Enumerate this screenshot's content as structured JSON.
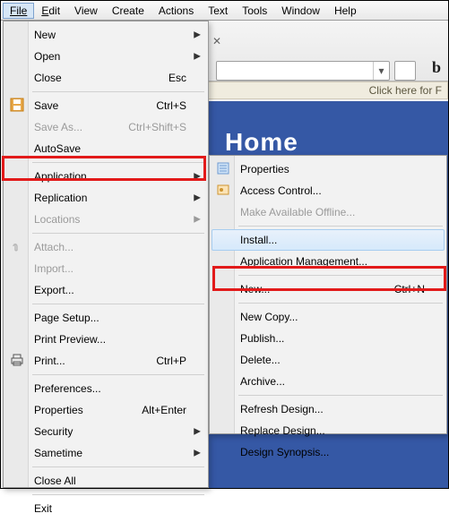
{
  "menubar": {
    "file": "File",
    "edit": "Edit",
    "view": "View",
    "create": "Create",
    "actions": "Actions",
    "text": "Text",
    "tools": "Tools",
    "window": "Window",
    "help": "Help"
  },
  "banner": {
    "click_here": "Click here for F"
  },
  "page": {
    "home": "Home"
  },
  "glyph_b": "b",
  "fileMenu": {
    "new": "New",
    "open": "Open",
    "close": "Close",
    "close_shortcut": "Esc",
    "save": "Save",
    "save_shortcut": "Ctrl+S",
    "save_as": "Save As...",
    "save_as_shortcut": "Ctrl+Shift+S",
    "autosave": "AutoSave",
    "application": "Application",
    "replication": "Replication",
    "locations": "Locations",
    "attach": "Attach...",
    "import": "Import...",
    "export": "Export...",
    "page_setup": "Page Setup...",
    "print_preview": "Print Preview...",
    "print": "Print...",
    "print_shortcut": "Ctrl+P",
    "preferences": "Preferences...",
    "properties": "Properties",
    "properties_shortcut": "Alt+Enter",
    "security": "Security",
    "sametime": "Sametime",
    "close_all": "Close All",
    "exit": "Exit"
  },
  "appMenu": {
    "properties": "Properties",
    "access_control": "Access Control...",
    "make_offline": "Make Available Offline...",
    "install": "Install...",
    "app_mgmt": "Application Management...",
    "new": "New...",
    "new_shortcut": "Ctrl+N",
    "new_copy": "New Copy...",
    "publish": "Publish...",
    "delete": "Delete...",
    "archive": "Archive...",
    "refresh": "Refresh Design...",
    "replace": "Replace Design...",
    "synopsis": "Design Synopsis..."
  }
}
